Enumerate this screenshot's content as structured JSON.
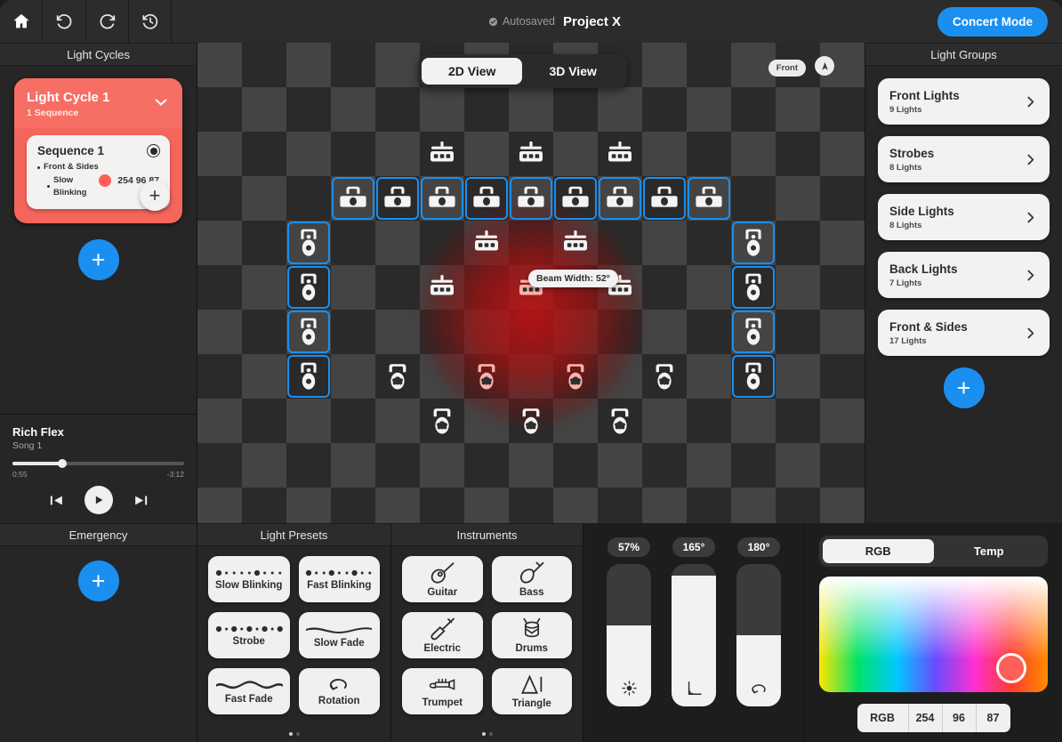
{
  "topbar": {
    "home_icon": "home-icon",
    "undo_icon": "undo-icon",
    "redo_icon": "redo-icon",
    "history_icon": "history-icon",
    "autosaved_label": "Autosaved",
    "project_title": "Project X",
    "concert_mode_label": "Concert Mode",
    "accent_color": "#1a8ff0"
  },
  "light_cycles": {
    "header": "Light Cycles",
    "cycle": {
      "title": "Light Cycle 1",
      "subtitle": "1 Sequence",
      "color": "#f76e64",
      "sequence": {
        "title": "Sequence 1",
        "bullet_1": "Front & Sides",
        "bullet_2": "Slow Blinking",
        "color_swatch": "#fe6057",
        "rgb_text": "254 96 87"
      },
      "add_sequence_label": "+"
    },
    "add_cycle_label": "+"
  },
  "player": {
    "song_title": "Rich Flex",
    "song_sub": "Song 1",
    "elapsed": "0:55",
    "remaining": "-3:12",
    "progress_percent": 29,
    "prev_icon": "previous-track-icon",
    "play_icon": "play-icon",
    "next_icon": "next-track-icon"
  },
  "emergency": {
    "header": "Emergency",
    "add_label": "+"
  },
  "stage": {
    "view_tabs": [
      {
        "label": "2D View",
        "active": true
      },
      {
        "label": "3D View",
        "active": false
      }
    ],
    "orientation_pill": "Front",
    "compass_icon": "compass-north-icon",
    "tooltip": "Beam Width: 52°",
    "cell_size": 50,
    "checker_light": "#444444",
    "checker_dark": "#2a2a2a",
    "selection_color": "#1a8ff0",
    "glow_color": "#c41212",
    "fixtures": [
      {
        "col": 5,
        "row": 2,
        "type": "bar",
        "selected": false,
        "lit": false
      },
      {
        "col": 7,
        "row": 2,
        "type": "bar",
        "selected": false,
        "lit": false
      },
      {
        "col": 9,
        "row": 2,
        "type": "bar",
        "selected": false,
        "lit": false
      },
      {
        "col": 3,
        "row": 3,
        "type": "par",
        "selected": true,
        "lit": false
      },
      {
        "col": 4,
        "row": 3,
        "type": "par",
        "selected": true,
        "lit": false
      },
      {
        "col": 5,
        "row": 3,
        "type": "par",
        "selected": true,
        "lit": false
      },
      {
        "col": 6,
        "row": 3,
        "type": "par",
        "selected": true,
        "lit": false
      },
      {
        "col": 7,
        "row": 3,
        "type": "par",
        "selected": true,
        "lit": false
      },
      {
        "col": 8,
        "row": 3,
        "type": "par",
        "selected": true,
        "lit": false
      },
      {
        "col": 9,
        "row": 3,
        "type": "par",
        "selected": true,
        "lit": false
      },
      {
        "col": 10,
        "row": 3,
        "type": "par",
        "selected": true,
        "lit": false
      },
      {
        "col": 11,
        "row": 3,
        "type": "par",
        "selected": true,
        "lit": false
      },
      {
        "col": 2,
        "row": 4,
        "type": "spot",
        "selected": true,
        "lit": false
      },
      {
        "col": 6,
        "row": 4,
        "type": "bar",
        "selected": false,
        "lit": false
      },
      {
        "col": 8,
        "row": 4,
        "type": "bar",
        "selected": false,
        "lit": false
      },
      {
        "col": 12,
        "row": 4,
        "type": "spot",
        "selected": true,
        "lit": false
      },
      {
        "col": 2,
        "row": 5,
        "type": "spot",
        "selected": true,
        "lit": false
      },
      {
        "col": 5,
        "row": 5,
        "type": "bar",
        "selected": false,
        "lit": false
      },
      {
        "col": 7,
        "row": 5,
        "type": "bar",
        "selected": false,
        "lit": true
      },
      {
        "col": 9,
        "row": 5,
        "type": "bar",
        "selected": false,
        "lit": false
      },
      {
        "col": 12,
        "row": 5,
        "type": "spot",
        "selected": true,
        "lit": false
      },
      {
        "col": 2,
        "row": 6,
        "type": "spot",
        "selected": true,
        "lit": false
      },
      {
        "col": 12,
        "row": 6,
        "type": "spot",
        "selected": true,
        "lit": false
      },
      {
        "col": 2,
        "row": 7,
        "type": "spot",
        "selected": true,
        "lit": false
      },
      {
        "col": 4,
        "row": 7,
        "type": "wash",
        "selected": false,
        "lit": false
      },
      {
        "col": 6,
        "row": 7,
        "type": "wash",
        "selected": false,
        "lit": true
      },
      {
        "col": 8,
        "row": 7,
        "type": "wash",
        "selected": false,
        "lit": true
      },
      {
        "col": 10,
        "row": 7,
        "type": "wash",
        "selected": false,
        "lit": false
      },
      {
        "col": 12,
        "row": 7,
        "type": "spot",
        "selected": true,
        "lit": false
      },
      {
        "col": 5,
        "row": 8,
        "type": "wash",
        "selected": false,
        "lit": false
      },
      {
        "col": 7,
        "row": 8,
        "type": "wash",
        "selected": false,
        "lit": false
      },
      {
        "col": 9,
        "row": 8,
        "type": "wash",
        "selected": false,
        "lit": false
      }
    ]
  },
  "light_groups": {
    "header": "Light Groups",
    "items": [
      {
        "name": "Front Lights",
        "count": "9 Lights"
      },
      {
        "name": "Strobes",
        "count": "8 Lights"
      },
      {
        "name": "Side Lights",
        "count": "8 Lights"
      },
      {
        "name": "Back Lights",
        "count": "7 Lights"
      },
      {
        "name": "Front & Sides",
        "count": "17 Lights"
      }
    ],
    "add_label": "+"
  },
  "light_presets": {
    "header": "Light Presets",
    "items": [
      {
        "label": "Slow Blinking",
        "icon": "slow-blinking-icon"
      },
      {
        "label": "Fast Blinking",
        "icon": "fast-blinking-icon"
      },
      {
        "label": "Strobe",
        "icon": "strobe-icon"
      },
      {
        "label": "Slow Fade",
        "icon": "slow-fade-icon"
      },
      {
        "label": "Fast Fade",
        "icon": "fast-fade-icon"
      },
      {
        "label": "Rotation",
        "icon": "rotation-icon"
      }
    ],
    "page": 1,
    "pages": 2
  },
  "instruments": {
    "header": "Instruments",
    "items": [
      {
        "label": "Guitar",
        "icon": "acoustic-guitar-icon"
      },
      {
        "label": "Bass",
        "icon": "bass-guitar-icon"
      },
      {
        "label": "Electric",
        "icon": "electric-guitar-icon"
      },
      {
        "label": "Drums",
        "icon": "drums-icon"
      },
      {
        "label": "Trumpet",
        "icon": "trumpet-icon"
      },
      {
        "label": "Triangle",
        "icon": "triangle-icon"
      }
    ],
    "page": 1,
    "pages": 2
  },
  "sliders": [
    {
      "name": "brightness",
      "value_label": "57%",
      "fill_percent": 57,
      "icon": "brightness-icon"
    },
    {
      "name": "beam-angle",
      "value_label": "165°",
      "fill_percent": 92,
      "icon": "angle-icon"
    },
    {
      "name": "rotation",
      "value_label": "180°",
      "fill_percent": 50,
      "icon": "rotation-icon"
    }
  ],
  "color_picker": {
    "tabs": [
      {
        "label": "RGB",
        "active": true
      },
      {
        "label": "Temp",
        "active": false
      }
    ],
    "selected_color": "#fe6057",
    "mode_label": "RGB",
    "r": "254",
    "g": "96",
    "b": "87"
  }
}
